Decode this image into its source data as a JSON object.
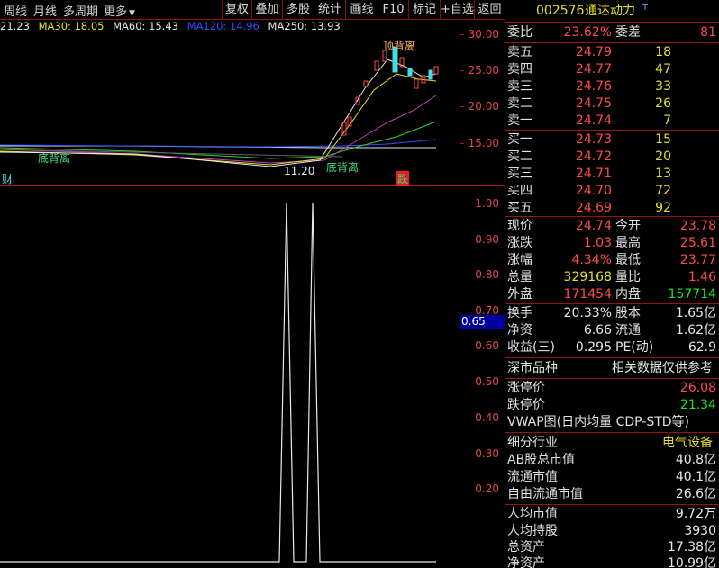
{
  "toolbar": {
    "left_items": [
      "周线",
      "月线",
      "多周期",
      "更多"
    ],
    "buttons": [
      "复权",
      "叠加",
      "多股",
      "统计",
      "画线",
      "F10",
      "标记",
      "+自选",
      "返回"
    ]
  },
  "ma_legend": [
    {
      "text": "21.23",
      "color": "#e8e8e8"
    },
    {
      "text": "MA30: 18.05",
      "color": "#e8e020"
    },
    {
      "text": "MA60: 15.43",
      "color": "#e8e8e8"
    },
    {
      "text": "MA120: 14.96",
      "color": "#3050ff"
    },
    {
      "text": "MA250: 13.93",
      "color": "#e8e8e8"
    }
  ],
  "price_axis": [
    "30.00",
    "25.00",
    "20.00",
    "15.00"
  ],
  "indicator_axis": [
    "1.00",
    "0.90",
    "0.80",
    "0.70",
    "0.60",
    "0.50",
    "0.40",
    "0.30",
    "0.20"
  ],
  "indicator_marker": "0.65",
  "chart_labels": {
    "top_label": "顶背离",
    "bottom_label_1": "底背离",
    "bottom_label_2": "底背离",
    "low_price": "11.20",
    "left_tag": "财",
    "right_tag": "跌"
  },
  "stock": {
    "code": "002576",
    "name": "通达动力",
    "flag": "T"
  },
  "commission": {
    "ratio_label": "委比",
    "ratio": "23.62%",
    "diff_label": "委差",
    "diff": "81"
  },
  "asks": [
    {
      "label": "卖五",
      "price": "24.79",
      "vol": "18"
    },
    {
      "label": "卖四",
      "price": "24.77",
      "vol": "47"
    },
    {
      "label": "卖三",
      "price": "24.76",
      "vol": "33"
    },
    {
      "label": "卖二",
      "price": "24.75",
      "vol": "26"
    },
    {
      "label": "卖一",
      "price": "24.74",
      "vol": "7"
    }
  ],
  "bids": [
    {
      "label": "买一",
      "price": "24.73",
      "vol": "15"
    },
    {
      "label": "买二",
      "price": "24.72",
      "vol": "20"
    },
    {
      "label": "买三",
      "price": "24.71",
      "vol": "13"
    },
    {
      "label": "买四",
      "price": "24.70",
      "vol": "72"
    },
    {
      "label": "买五",
      "price": "24.69",
      "vol": "92"
    }
  ],
  "quote": [
    {
      "l1": "现价",
      "v1": "24.74",
      "c1": "red",
      "l2": "今开",
      "v2": "23.78",
      "c2": "red"
    },
    {
      "l1": "涨跌",
      "v1": "1.03",
      "c1": "red",
      "l2": "最高",
      "v2": "25.61",
      "c2": "red"
    },
    {
      "l1": "涨幅",
      "v1": "4.34%",
      "c1": "red",
      "l2": "最低",
      "v2": "23.77",
      "c2": "red"
    },
    {
      "l1": "总量",
      "v1": "329168",
      "c1": "yellow",
      "l2": "量比",
      "v2": "1.46",
      "c2": "red"
    },
    {
      "l1": "外盘",
      "v1": "171454",
      "c1": "red",
      "l2": "内盘",
      "v2": "157714",
      "c2": "green"
    }
  ],
  "stats": [
    {
      "l1": "换手",
      "v1": "20.33%",
      "l2": "股本",
      "v2": "1.65亿"
    },
    {
      "l1": "净资",
      "v1": "6.66",
      "l2": "流通",
      "v2": "1.62亿"
    },
    {
      "l1": "收益(三)",
      "v1": "0.295",
      "l2": "PE(动)",
      "v2": "62.9"
    }
  ],
  "market": {
    "left": "深市品种",
    "right": "相关数据仅供参考"
  },
  "limits": [
    {
      "label": "涨停价",
      "value": "26.08",
      "color": "red"
    },
    {
      "label": "跌停价",
      "value": "21.34",
      "color": "green"
    }
  ],
  "vwap": "VWAP图(日内均量 CDP-STD等)",
  "industry": {
    "label": "细分行业",
    "value": "电气设备"
  },
  "caps": [
    {
      "label": "AB股总市值",
      "value": "40.8亿"
    },
    {
      "label": "流通市值",
      "value": "40.1亿"
    },
    {
      "label": "自由流通市值",
      "value": "26.6亿"
    }
  ],
  "per_capita": [
    {
      "label": "人均市值",
      "value": "9.72万"
    },
    {
      "label": "人均持股",
      "value": "3930"
    },
    {
      "label": "总资产",
      "value": "17.38亿"
    },
    {
      "label": "净资产",
      "value": "10.99亿"
    }
  ]
}
